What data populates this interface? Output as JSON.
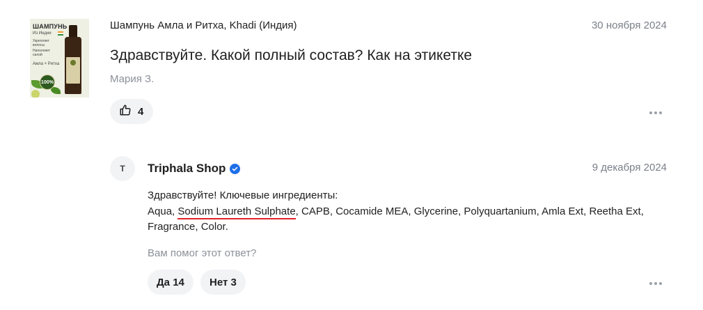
{
  "question": {
    "product_title": "Шампунь Амла и Ритха, Khadi (Индия)",
    "date": "30 ноября 2024",
    "text": "Здравствуйте. Какой полный состав? Как на этикетке",
    "author": "Мария З.",
    "likes": "4",
    "thumbnail": {
      "title": "ШАМПУНЬ",
      "origin": "Из Индии",
      "line1": "Укрепляет",
      "line2": "волосы",
      "line3": "Наполняет",
      "line4": "силой",
      "variant": "Амла + Ритха",
      "badge": "100%"
    }
  },
  "answer": {
    "avatar_initial": "T",
    "shop_name": "Triphala Shop",
    "date": "9 декабря 2024",
    "line1": "Здравствуйте! Ключевые ингредиенты:",
    "ingredients_before": "Aqua, ",
    "ingredients_underlined": "Sodium Laureth Sulphate",
    "ingredients_after": ", CAPB, Cocamide MEA, Glycerine, Polyquartanium, Amla Ext, Reetha Ext, Fragrance, Color.",
    "helpful_question": "Вам помог этот ответ?",
    "vote_yes": "Да 14",
    "vote_no": "Нет 3"
  },
  "colors": {
    "accent_underline": "#e0222c",
    "verified_badge": "#1e6fe8",
    "button_bg": "#f2f3f5",
    "muted_text": "#8b9099"
  }
}
